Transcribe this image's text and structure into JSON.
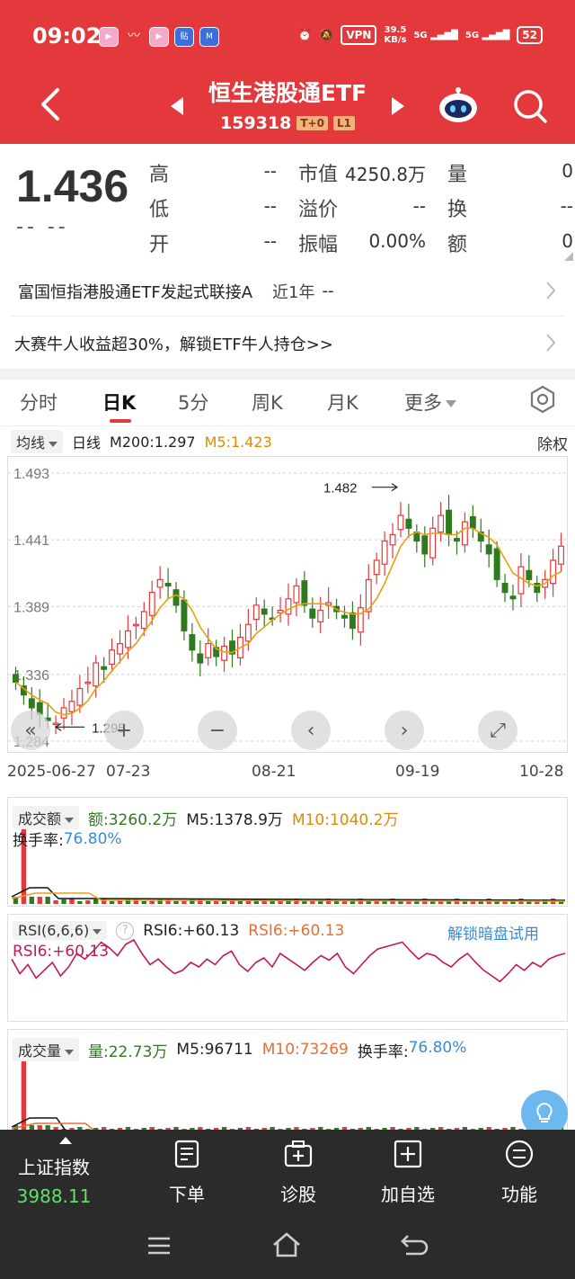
{
  "status_bar": {
    "time": "09:02",
    "vpn": "VPN",
    "speed_value": "39.5",
    "speed_unit": "KB/s",
    "signal_1": "5G",
    "signal_2": "5G",
    "battery": "52"
  },
  "header": {
    "title": "恒生港股通ETF",
    "code": "159318",
    "tag_t0": "T+0",
    "tag_l1": "L1"
  },
  "quote": {
    "price": "1.436",
    "change": "-- --",
    "fields": [
      {
        "label": "高",
        "value": "--"
      },
      {
        "label": "低",
        "value": "--"
      },
      {
        "label": "开",
        "value": "--"
      },
      {
        "label": "市值",
        "value": "4250.8万"
      },
      {
        "label": "溢价",
        "value": "--"
      },
      {
        "label": "振幅",
        "value": "0.00%"
      },
      {
        "label": "量",
        "value": "0"
      },
      {
        "label": "换",
        "value": "--"
      },
      {
        "label": "额",
        "value": "0"
      }
    ]
  },
  "info_rows": {
    "fund_name": "富国恒指港股通ETF发起式联接A",
    "fund_period": "近1年",
    "fund_return": "--",
    "promo": "大赛牛人收益超30%，解锁ETF牛人持仓>>"
  },
  "tabs": {
    "items": [
      "分时",
      "日K",
      "5分",
      "周K",
      "月K",
      "更多"
    ],
    "active": "日K"
  },
  "indicator_row": {
    "ma_select": "均线",
    "period": "日线",
    "m200": "M200:1.297",
    "m5": "M5:1.423",
    "adjust": "除权"
  },
  "chart_data": {
    "type": "candlestick",
    "y_ticks": [
      "1.493",
      "1.441",
      "1.389",
      "1.336",
      "1.284"
    ],
    "ylim": [
      1.284,
      1.493
    ],
    "x_ticks": [
      "2025-06-27",
      "07-23",
      "08-21",
      "09-19",
      "10-28"
    ],
    "annotations": {
      "high": "1.482",
      "low": "1.295"
    },
    "ma5_color": "#e8a010",
    "up_color": "#e4393c",
    "down_color": "#2f7a1e",
    "close": [
      1.33,
      1.32,
      1.31,
      1.305,
      1.3,
      1.298,
      1.31,
      1.315,
      1.325,
      1.33,
      1.345,
      1.34,
      1.355,
      1.36,
      1.37,
      1.375,
      1.385,
      1.4,
      1.41,
      1.405,
      1.39,
      1.37,
      1.355,
      1.345,
      1.36,
      1.35,
      1.358,
      1.352,
      1.365,
      1.375,
      1.39,
      1.383,
      1.38,
      1.386,
      1.395,
      1.405,
      1.39,
      1.38,
      1.386,
      1.392,
      1.385,
      1.38,
      1.372,
      1.388,
      1.41,
      1.425,
      1.44,
      1.445,
      1.46,
      1.45,
      1.44,
      1.43,
      1.45,
      1.46,
      1.445,
      1.44,
      1.455,
      1.45,
      1.44,
      1.43,
      1.41,
      1.4,
      1.395,
      1.42,
      1.41,
      1.4,
      1.41,
      1.425,
      1.436
    ]
  },
  "volume_amount_panel": {
    "label": "成交额",
    "amount": "额:3260.2万",
    "m5": "M5:1378.9万",
    "m10": "M10:1040.2万",
    "turnover_label": "换手率:",
    "turnover": "76.80%"
  },
  "rsi_panel": {
    "label": "RSI(6,6,6)",
    "help": "?",
    "rsi_a": "RSI6:+60.13",
    "rsi_b": "RSI6:+60.13",
    "unlock": "解锁暗盘试用",
    "rsi_line_label": "RSI6:+60.13",
    "rsi_values": [
      55,
      42,
      50,
      38,
      45,
      52,
      40,
      48,
      60,
      55,
      62,
      70,
      65,
      58,
      68,
      72,
      60,
      50,
      55,
      48,
      42,
      45,
      52,
      48,
      55,
      50,
      58,
      62,
      50,
      44,
      52,
      56,
      48,
      60,
      55,
      50,
      45,
      52,
      58,
      54,
      60,
      48,
      42,
      50,
      58,
      64,
      66,
      68,
      70,
      62,
      55,
      60,
      58,
      52,
      48,
      55,
      60,
      52,
      45,
      40,
      35,
      42,
      50,
      45,
      52,
      48,
      55,
      58,
      60
    ]
  },
  "volume_panel": {
    "label": "成交量",
    "vol": "量:22.73万",
    "m5": "M5:96711",
    "m10": "M10:73269",
    "turnover_label": "换手率:",
    "turnover": "76.80%"
  },
  "bottom_bar": {
    "index_name": "上证指数",
    "index_value": "3988.11",
    "items": [
      "下单",
      "诊股",
      "加自选",
      "功能"
    ]
  }
}
